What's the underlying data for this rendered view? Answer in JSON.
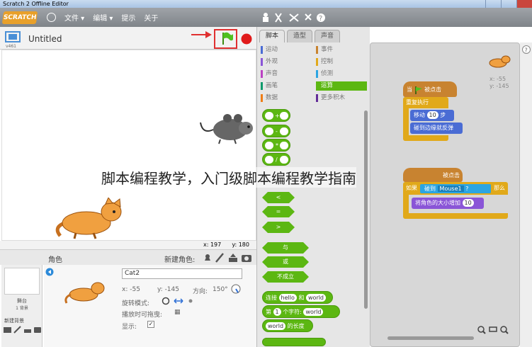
{
  "window": {
    "title": "Scratch 2 Offline Editor"
  },
  "menubar": {
    "logo": "SCRATCH",
    "file": "文件 ▾",
    "edit": "编辑 ▾",
    "tips": "提示",
    "about": "关于"
  },
  "stage": {
    "project_name": "Untitled",
    "version_label": "v461",
    "mouse_x": "x: 197",
    "mouse_y": "y: 180"
  },
  "sprites_pane": {
    "header": "角色",
    "new_sprite_label": "新建角色:",
    "stage_label": "舞台",
    "stage_backdrops": "1 背景",
    "new_backdrop_label": "新建背景"
  },
  "sprite_info": {
    "name": "Cat2",
    "x": "x: -55",
    "y": "y: -145",
    "direction_label": "方向:",
    "direction_value": "150°",
    "rotation_label": "旋转模式:",
    "draggable_label": "播放时可拖曳:",
    "show_label": "显示:",
    "show_checked": "✓",
    "draggable_box": "▦"
  },
  "tabs": [
    {
      "label": "脚本"
    },
    {
      "label": "造型"
    },
    {
      "label": "声音"
    }
  ],
  "categories": [
    {
      "label": "运动",
      "color": "#4a6cd4"
    },
    {
      "label": "事件",
      "color": "#c88330"
    },
    {
      "label": "外观",
      "color": "#8a55d7"
    },
    {
      "label": "控制",
      "color": "#e1a91a"
    },
    {
      "label": "声音",
      "color": "#bb42c3"
    },
    {
      "label": "侦测",
      "color": "#2ca5e2"
    },
    {
      "label": "画笔",
      "color": "#0e9a6c"
    },
    {
      "label": "运算",
      "color": "#5cb712"
    },
    {
      "label": "数据",
      "color": "#ee7d16"
    },
    {
      "label": "更多积木",
      "color": "#632d99"
    }
  ],
  "palette": {
    "ops_plus": "+",
    "ops_minus": "-",
    "ops_times": "*",
    "ops_div": "/",
    "ops_lt": "<",
    "ops_eq": "=",
    "ops_gt": ">",
    "and_label": "与",
    "or_label": "或",
    "not_label": "不成立",
    "join_label": "连接",
    "join_a": "hello",
    "join_and": "和",
    "join_b": "world",
    "letter_label": "第",
    "letter_n": "1",
    "letter_of": "个字符:",
    "letter_word": "world",
    "length_word": "world",
    "length_label": "的长度"
  },
  "scripts": {
    "sprite_x": "x: -55",
    "sprite_y": "y: -145",
    "s1_when": "当",
    "s1_clicked": "被点击",
    "s1_forever": "重复执行",
    "s1_move": "移动",
    "s1_steps_n": "10",
    "s1_steps": "步",
    "s1_bounce": "碰到边缘就反弹",
    "s2_clicked": "被点击",
    "s2_if": "如果",
    "s2_touching": "碰到",
    "s2_target": "Mouse1",
    "s2_q": "?",
    "s2_then": "那么",
    "s2_size": "将角色的大小增加",
    "s2_size_n": "10"
  },
  "watermark": "脚本编程教学，入门级脚本编程教学指南"
}
